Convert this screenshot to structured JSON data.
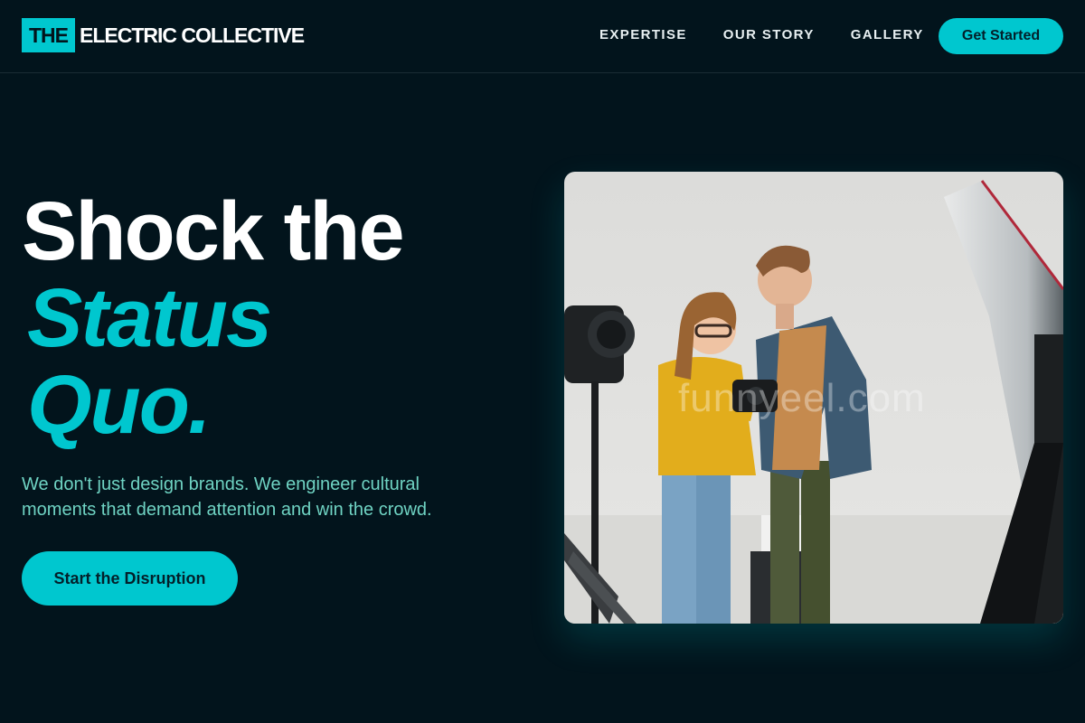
{
  "brand": {
    "mark": "THE",
    "name": "ELECTRIC COLLECTIVE",
    "accent_color": "#00c7cf",
    "background_color": "#02141c"
  },
  "nav": {
    "items": [
      {
        "label": "EXPERTISE"
      },
      {
        "label": "OUR STORY"
      },
      {
        "label": "GALLERY"
      }
    ],
    "cta_label": "Get Started"
  },
  "hero": {
    "headline_line1": "Shock the",
    "headline_line2": "Status",
    "headline_line3": "Quo.",
    "tagline": "We don't just design brands. We engineer cultural moments that demand attention and win the crowd.",
    "cta_label": "Start the Disruption",
    "image": {
      "subject": "photo-shoot-studio-image",
      "watermark": "funnyeel.com"
    }
  }
}
